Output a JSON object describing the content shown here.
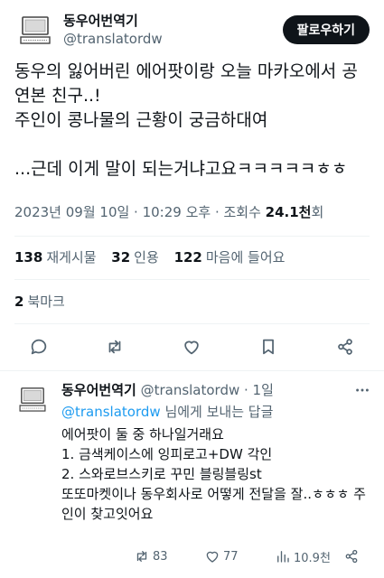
{
  "tweet": {
    "author": {
      "display_name": "동우어번역기",
      "handle": "@translatordw"
    },
    "follow_label": "팔로우하기",
    "text": "동우의 잃어버린 에어팟이랑 오늘 마카오에서 공연본 친구..!\n주인이 콩나물의 근황이 궁금하대여\n\n...근데 이게 말이 되는거냐고요ㅋㅋㅋㅋㅋㅎㅎ",
    "timestamp": "2023년 09월 10일 · 10:29 오후 · 조회수 ",
    "views": "24.1천",
    "views_suffix": "회"
  },
  "stats": {
    "retweets_count": "138",
    "retweets_label": "재게시물",
    "quotes_count": "32",
    "quotes_label": "인용",
    "likes_count": "122",
    "likes_label": "마음에 들어요",
    "bookmarks_count": "2",
    "bookmarks_label": "북마크"
  },
  "actions": {
    "icons": [
      "reply-icon",
      "retweet-icon",
      "like-icon",
      "bookmark-icon",
      "share-icon"
    ]
  },
  "reply": {
    "display_name": "동우어번역기",
    "handle_time": " @translatordw · 1일",
    "reply_to_mention": "@translatordw",
    "reply_to_suffix": " 님에게 보내는 답글",
    "text": "에어팟이 둘 중 하나일거래요\n1. 금색케이스에 잉피로고+DW 각인\n2. 스와로브스키로 꾸민 블링블링st\n또또마켓이나 동우회사로 어떻게 전달을 잘..ㅎㅎㅎ 주인이 찾고잇어요",
    "retweets": "83",
    "likes": "77",
    "views": "10.9천"
  },
  "colors": {
    "text": "#0f1419",
    "secondary": "#536471",
    "link": "#1d9bf0",
    "divider": "#eff3f4"
  }
}
